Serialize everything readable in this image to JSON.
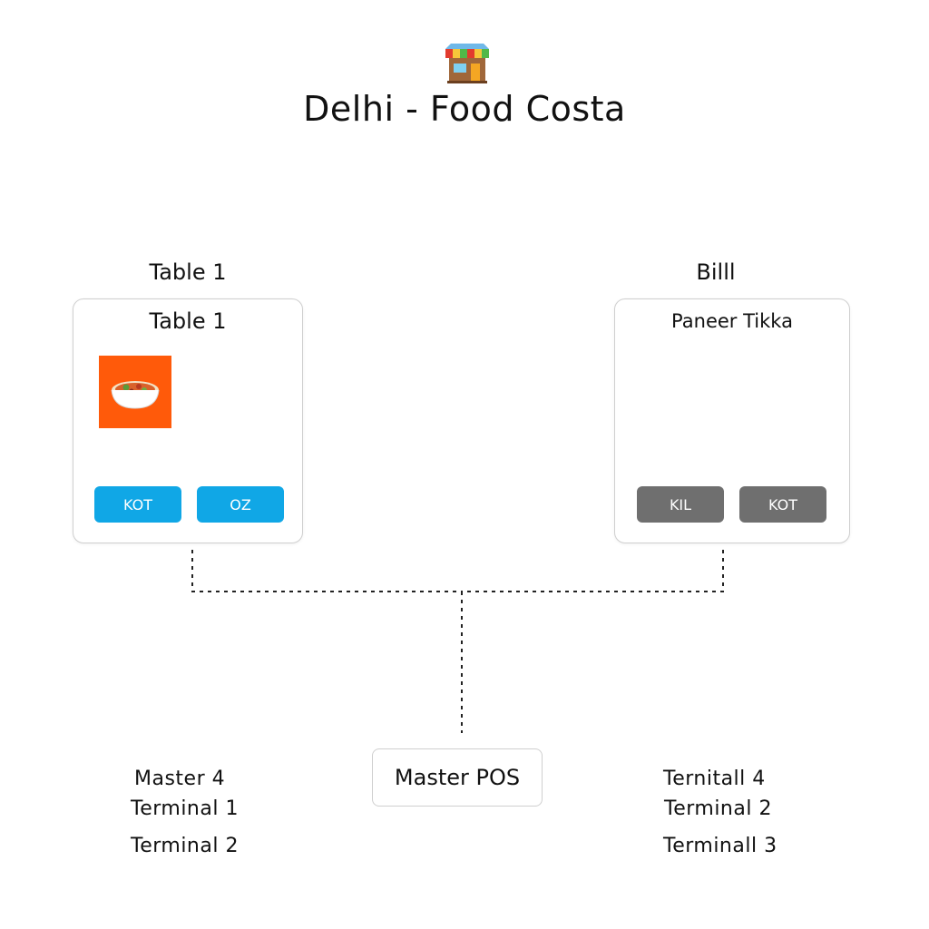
{
  "header": {
    "icon": "storefront-icon",
    "title": "Delhi - Food Costa"
  },
  "left_panel": {
    "heading": "Table 1",
    "card_title": "Table 1",
    "image": "curry-bowl-icon",
    "buttons": [
      "KOT",
      "OZ"
    ],
    "button_color": "#10a7e6"
  },
  "right_panel": {
    "heading": "Billl",
    "card_title": "Paneer Tikka",
    "buttons": [
      "KIL",
      "KOT"
    ],
    "button_color": "#6f6f6f"
  },
  "master": {
    "label": "Master POS"
  },
  "left_terminals": [
    "Master  4",
    "Terminal  1",
    "Terminal  2"
  ],
  "right_terminals": [
    "Ternitall  4",
    "Terminal  2",
    "Terminall  3"
  ],
  "colors": {
    "accent_blue": "#10a7e6",
    "gray_button": "#6f6f6f",
    "food_tile": "#ff5a0a"
  }
}
